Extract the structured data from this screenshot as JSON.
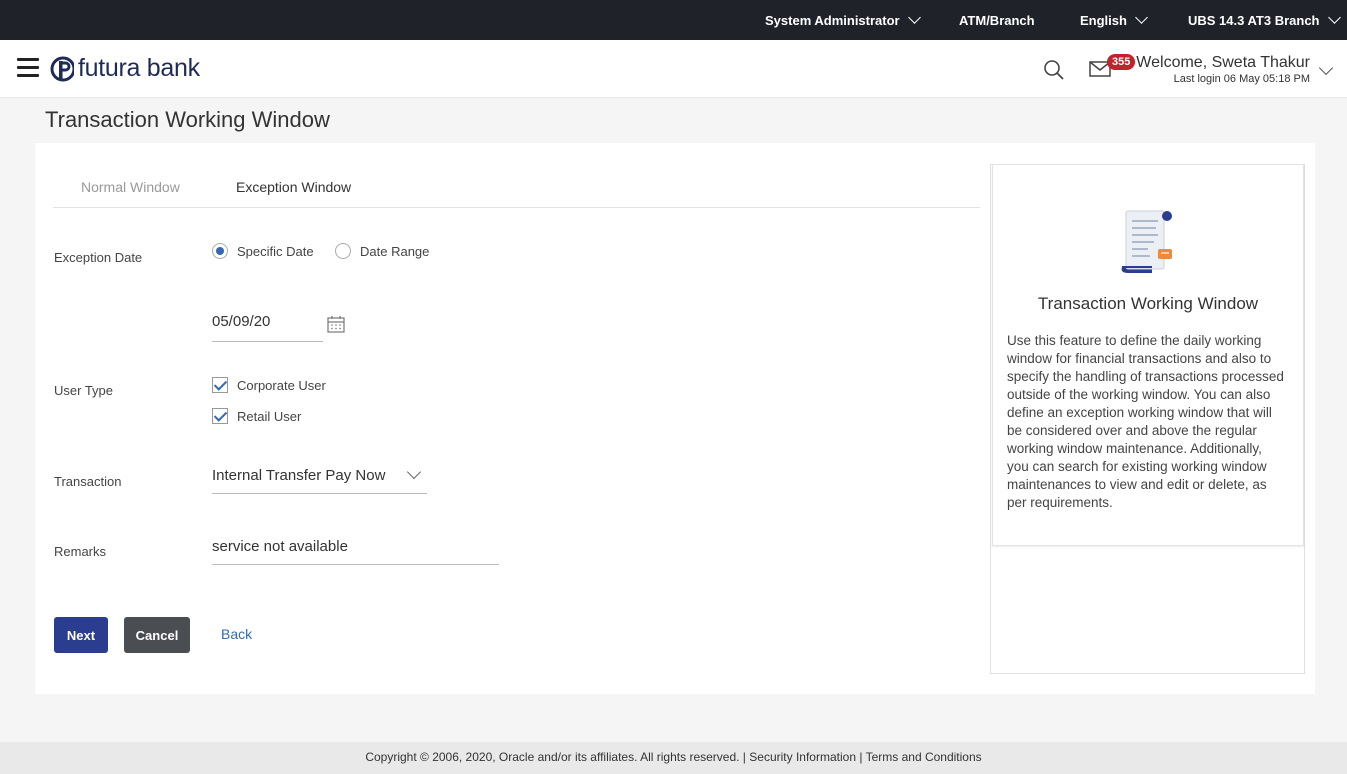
{
  "topbar": {
    "role": "System Administrator",
    "atm_branch": "ATM/Branch",
    "language": "English",
    "branch": "UBS 14.3 AT3 Branch"
  },
  "header": {
    "logo_text": "futura bank",
    "mail_count": "355",
    "welcome": "Welcome, Sweta Thakur",
    "last_login": "Last login 06 May 05:18 PM"
  },
  "page_title": "Transaction Working Window",
  "tabs": [
    {
      "label": "Normal Window"
    },
    {
      "label": "Exception Window"
    }
  ],
  "form": {
    "exception_date_label": "Exception Date",
    "radio_specific": "Specific Date",
    "radio_range": "Date Range",
    "date_value": "05/09/20",
    "user_type_label": "User Type",
    "corporate_user": "Corporate User",
    "retail_user": "Retail User",
    "transaction_label": "Transaction",
    "transaction_value": "Internal Transfer Pay Now",
    "remarks_label": "Remarks",
    "remarks_value": "service not available"
  },
  "buttons": {
    "next": "Next",
    "cancel": "Cancel",
    "back": "Back"
  },
  "help": {
    "title": "Transaction Working Window",
    "text": "Use this feature to define the daily working window for financial transactions and also to specify the handling of transactions processed outside of the working window. You can also define an exception working window that will be considered over and above the regular working window maintenance. Additionally, you can search for existing working window maintenances to view and edit or delete, as per requirements."
  },
  "footer": {
    "copyright": "Copyright © 2006, 2020, Oracle and/or its affiliates. All rights reserved. |",
    "security": "Security Information",
    "sep": "|",
    "terms": "Terms and Conditions"
  },
  "colors": {
    "topbar": "#1f2329",
    "brand": "#1e2b57",
    "next_button": "#2a3d8f",
    "cancel_button": "#4a4d52",
    "badge": "#c0232c"
  }
}
